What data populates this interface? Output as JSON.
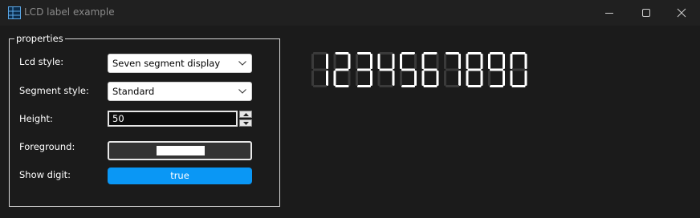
{
  "window": {
    "title": "LCD label example",
    "icon": "grid-window-icon"
  },
  "properties": {
    "group_title": "properties",
    "lcd_style": {
      "label": "Lcd style:",
      "value": "Seven segment display"
    },
    "segment_style": {
      "label": "Segment style:",
      "value": "Standard"
    },
    "height": {
      "label": "Height:",
      "value": "50"
    },
    "foreground": {
      "label": "Foreground:",
      "color": "#ffffff"
    },
    "show_digit": {
      "label": "Show digit:",
      "value": "true",
      "color": "#0a97f5"
    }
  },
  "lcd": {
    "text": "1234567890",
    "on_color": "#ffffff",
    "off_color": "#3a3a3a"
  }
}
